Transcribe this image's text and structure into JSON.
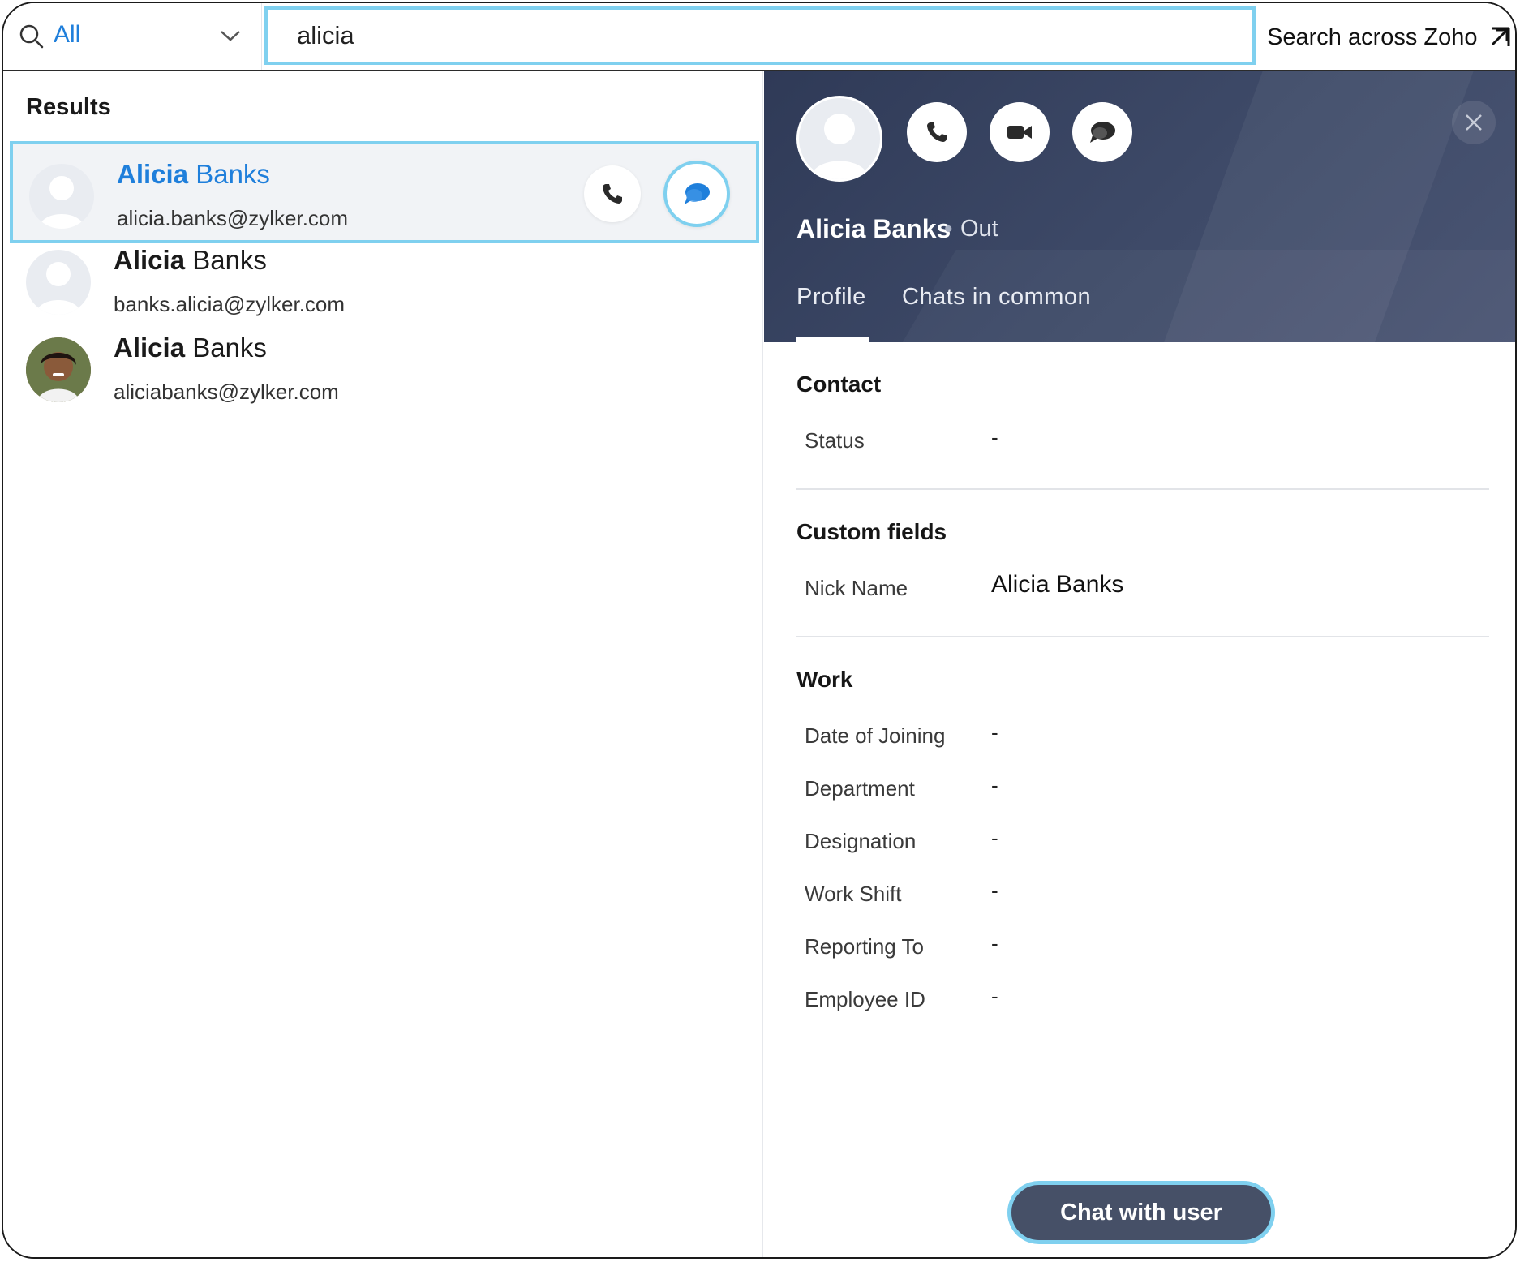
{
  "search": {
    "scope_label": "All",
    "query": "alicia",
    "search_across_label": "Search across Zoho"
  },
  "results": {
    "title": "Results",
    "items": [
      {
        "first": "Alicia",
        "last": "Banks",
        "email": "alicia.banks@zylker.com",
        "avatar": "default-avatar-icon",
        "selected": true
      },
      {
        "first": "Alicia",
        "last": "Banks",
        "email": "banks.alicia@zylker.com",
        "avatar": "default-avatar-icon",
        "selected": false
      },
      {
        "first": "Alicia",
        "last": "Banks",
        "email": "aliciabanks@zylker.com",
        "avatar": "photo",
        "selected": false
      }
    ]
  },
  "profile": {
    "name": "Alicia Banks",
    "status": "Out",
    "tabs": [
      "Profile",
      "Chats in common"
    ],
    "active_tab": "Profile",
    "contact": {
      "title": "Contact",
      "fields": [
        {
          "label": "Status",
          "value": "-"
        }
      ]
    },
    "custom": {
      "title": "Custom fields",
      "fields": [
        {
          "label": "Nick Name",
          "value": "Alicia Banks"
        }
      ]
    },
    "work": {
      "title": "Work",
      "fields": [
        {
          "label": "Date of Joining",
          "value": "-"
        },
        {
          "label": "Department",
          "value": "-"
        },
        {
          "label": "Designation",
          "value": "-"
        },
        {
          "label": "Work Shift",
          "value": "-"
        },
        {
          "label": "Reporting To",
          "value": "-"
        },
        {
          "label": "Employee ID",
          "value": "-"
        }
      ]
    },
    "chat_button_label": "Chat with user"
  },
  "colors": {
    "accent": "#1f7fdb",
    "focus_ring": "#7fd0ef",
    "hero_bg": "#3e4a68",
    "chat_button": "#465067"
  }
}
